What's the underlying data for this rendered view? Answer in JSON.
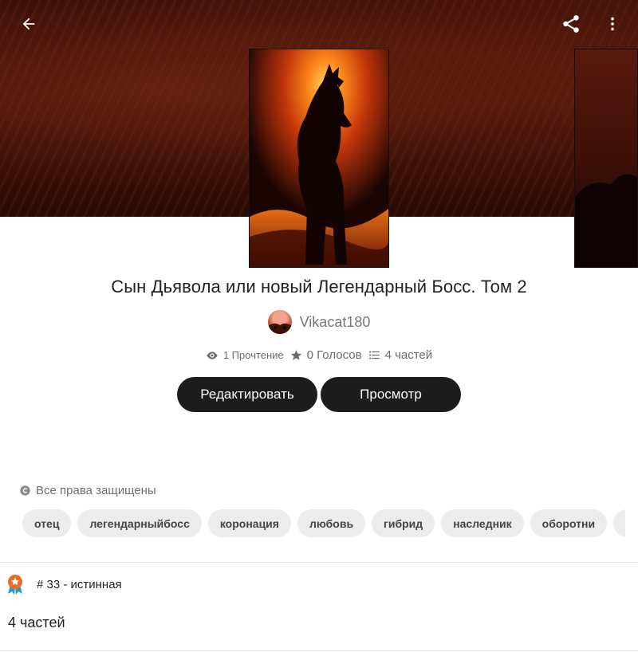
{
  "header": {
    "back_icon": "arrow-left-icon",
    "share_icon": "share-icon",
    "more_icon": "more-vertical-icon"
  },
  "story": {
    "title": "Сын Дьявола или новый Легендарный Босс. Том 2",
    "author": "Vikacat180",
    "reads": "1 Прочтение",
    "votes": "0 Голосов",
    "parts": "4 частей"
  },
  "actions": {
    "edit_label": "Редактировать",
    "view_label": "Просмотр"
  },
  "copyright": "Все права защищены",
  "tags": [
    "отец",
    "легендарныйбосс",
    "коронация",
    "любовь",
    "гибрид",
    "наследник",
    "оборотни"
  ],
  "ranking": {
    "text": "# 33 - истинная"
  },
  "parts_section": {
    "label": "4 частей"
  },
  "colors": {
    "button_bg": "#1c1c1c",
    "tag_bg": "#ececec",
    "rank_badge": "#f36a1e"
  }
}
